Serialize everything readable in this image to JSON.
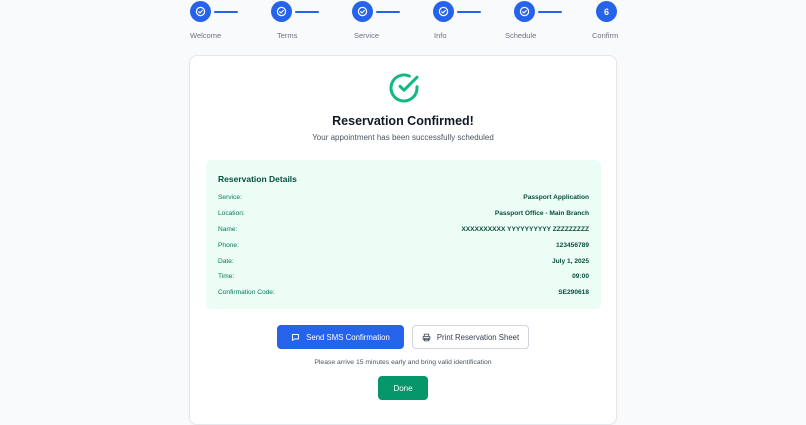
{
  "stepper": {
    "steps": [
      {
        "label": "Welcome",
        "icon": "check-icon"
      },
      {
        "label": "Terms",
        "icon": "check-icon"
      },
      {
        "label": "Service",
        "icon": "check-icon"
      },
      {
        "label": "Info",
        "icon": "check-icon"
      },
      {
        "label": "Schedule",
        "icon": "check-icon"
      },
      {
        "label": "Confirm",
        "number": "6"
      }
    ],
    "accent_color": "#2563eb"
  },
  "confirmation": {
    "icon": "check-circle-icon",
    "icon_color": "#10b981",
    "title": "Reservation Confirmed!",
    "subtitle": "Your appointment has been successfully scheduled"
  },
  "details": {
    "title": "Reservation Details",
    "rows": [
      {
        "label": "Service:",
        "value": "Passport Application"
      },
      {
        "label": "Location:",
        "value": "Passport Office - Main Branch"
      },
      {
        "label": "Name:",
        "value": "XXXXXXXXXX YYYYYYYYYY ZZZZZZZZZ"
      },
      {
        "label": "Phone:",
        "value": "123456789"
      },
      {
        "label": "Date:",
        "value": "July 1, 2025"
      },
      {
        "label": "Time:",
        "value": "09:00"
      },
      {
        "label": "Confirmation Code:",
        "value": "SE290618"
      }
    ]
  },
  "actions": {
    "sms_label": "Send SMS Confirmation",
    "sms_icon": "message-icon",
    "print_label": "Print Reservation Sheet",
    "print_icon": "printer-icon",
    "note": "Please arrive 15 minutes early and bring valid identification",
    "done_label": "Done"
  }
}
